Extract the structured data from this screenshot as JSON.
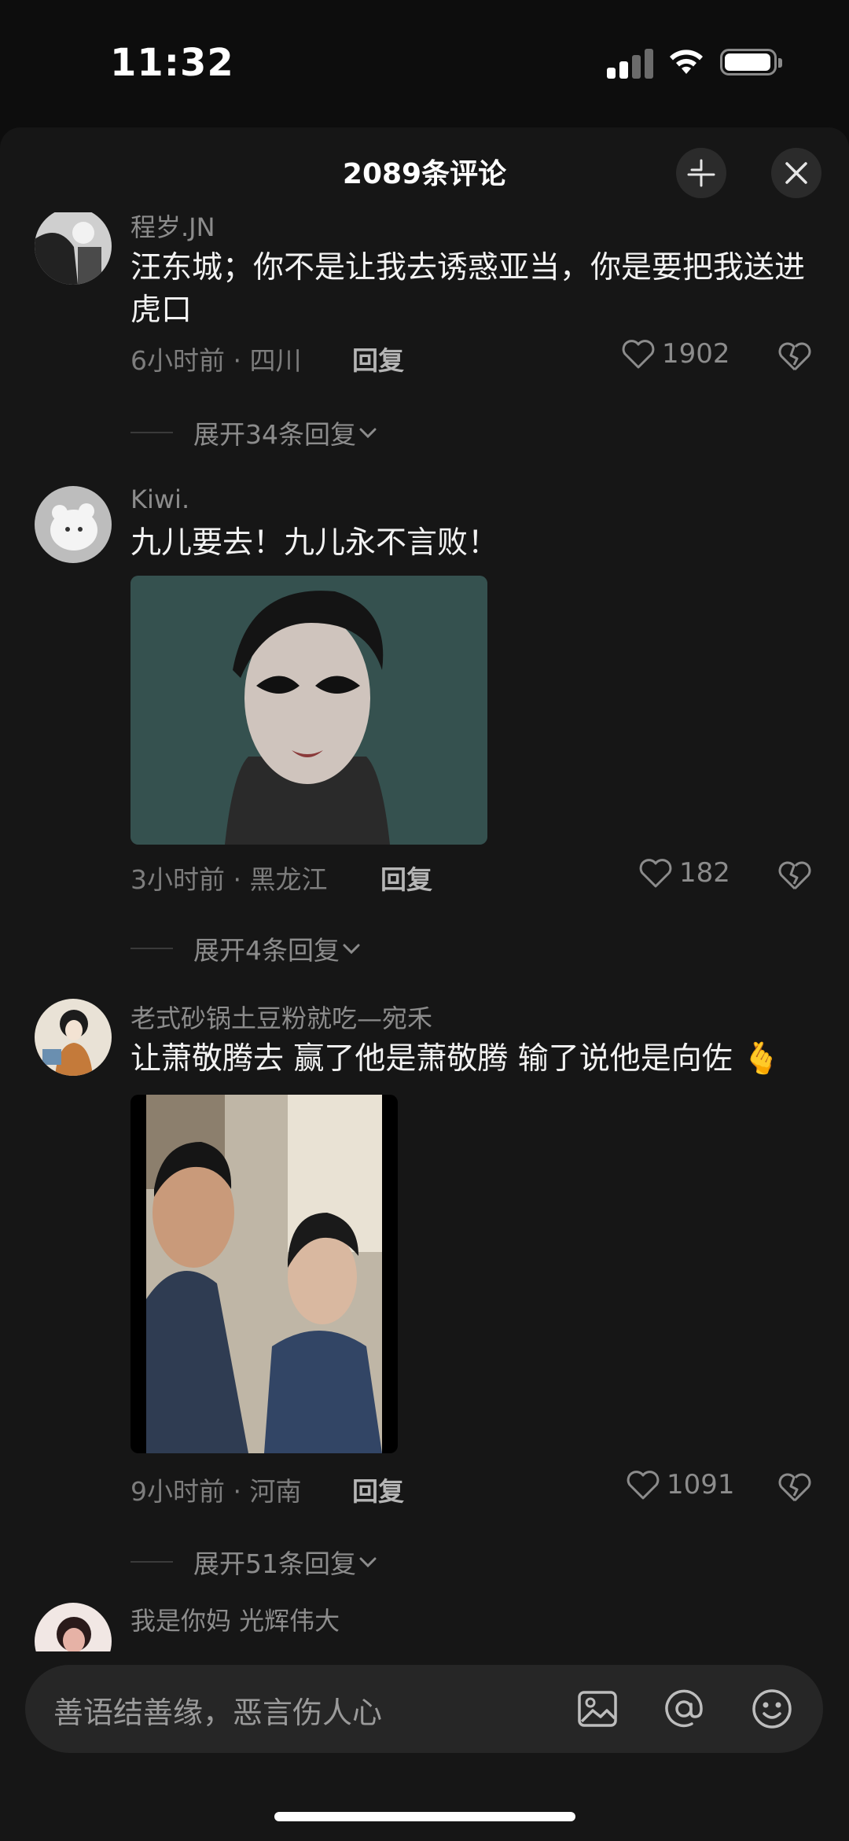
{
  "status_bar": {
    "time": "11:32"
  },
  "header": {
    "title": "2089条评论"
  },
  "comments": [
    {
      "username": "程岁.JN",
      "text": "汪东城；你不是让我去诱惑亚当，你是要把我送进虎口",
      "meta": "6小时前 · 四川",
      "reply": "回复",
      "likes": "1902",
      "expand": "展开34条回复"
    },
    {
      "username": "Kiwi.",
      "text": "九儿要去！九儿永不言败！",
      "meta": "3小时前 · 黑龙江",
      "reply": "回复",
      "likes": "182",
      "expand": "展开4条回复"
    },
    {
      "username": "老式砂锅土豆粉就吃—宛禾",
      "text": "让萧敬腾去 赢了他是萧敬腾 输了说他是向佐 🫰",
      "meta": "9小时前 · 河南",
      "reply": "回复",
      "likes": "1091",
      "expand": "展开51条回复"
    },
    {
      "username": "我是你妈 光辉伟大"
    }
  ],
  "input": {
    "placeholder": "善语结善缘，恶言伤人心"
  },
  "colors": {
    "background": "#161616",
    "text_secondary": "#8c8c8c"
  }
}
